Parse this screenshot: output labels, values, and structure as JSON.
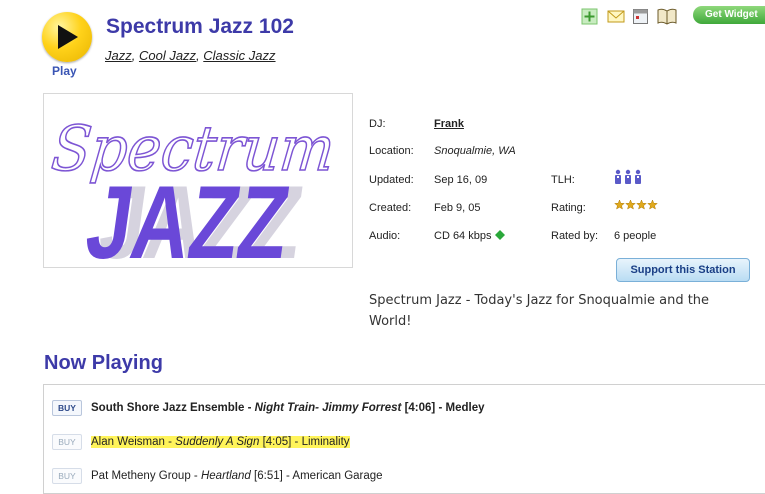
{
  "player": {
    "play_label": "Play"
  },
  "station": {
    "title": "Spectrum Jazz 102",
    "genres": [
      "Jazz",
      "Cool Jazz",
      "Classic Jazz"
    ],
    "logo_script_text": "Spectrum",
    "logo_block_text": "JAZZ"
  },
  "toolbar": {
    "widget_label": "Get Widget",
    "icons": [
      "add-icon",
      "mail-icon",
      "calendar-icon",
      "book-icon"
    ]
  },
  "info": {
    "dj_label": "DJ:",
    "dj_value": "Frank",
    "location_label": "Location:",
    "location_value": "Snoqualmie, WA",
    "updated_label": "Updated:",
    "updated_value": "Sep 16, 09",
    "created_label": "Created:",
    "created_value": "Feb 9, 05",
    "audio_label": "Audio:",
    "audio_value": "CD 64 kbps",
    "tlh_label": "TLH:",
    "rating_label": "Rating:",
    "rating_stars": 4,
    "rated_by_label": "Rated by:",
    "rated_by_value": "6 people"
  },
  "support_label": "Support this Station",
  "description": "Spectrum Jazz - Today's Jazz for Snoqualmie and the World!",
  "now_playing": {
    "title": "Now Playing",
    "buy_label": "BUY",
    "tracks": [
      {
        "artist": "South Shore Jazz Ensemble",
        "song": "Night Train- Jimmy Forrest",
        "duration": "[4:06]",
        "album": "Medley",
        "bold": true,
        "highlight": false
      },
      {
        "artist": "Alan Weisman",
        "song": "Suddenly A Sign",
        "duration": "[4:05]",
        "album": "Liminality",
        "bold": false,
        "highlight": true
      },
      {
        "artist": "Pat Metheny Group",
        "song": "Heartland",
        "duration": "[6:51]",
        "album": "American Garage",
        "bold": false,
        "highlight": false
      }
    ]
  },
  "colors": {
    "accent": "#3d3aa8",
    "logo_purple": "#6a48d8",
    "play_yellow": "#ffd21a",
    "highlight": "#fff45a"
  }
}
